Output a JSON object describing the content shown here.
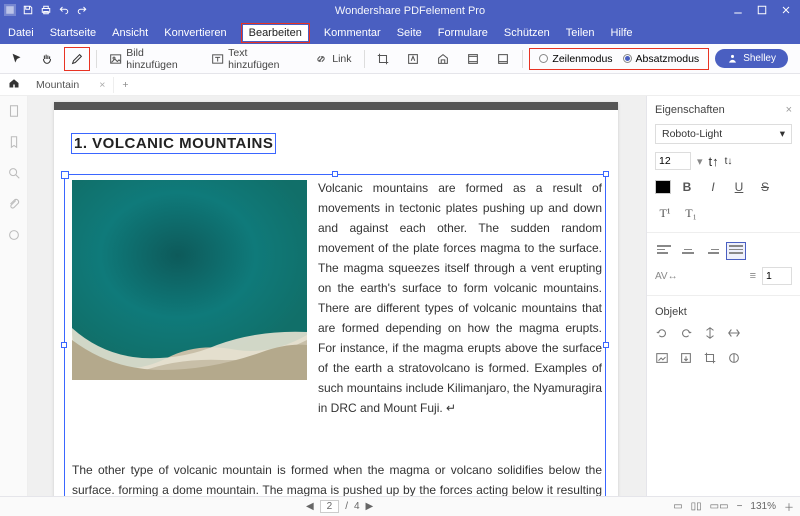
{
  "titlebar": {
    "title": "Wondershare PDFelement Pro"
  },
  "menubar": [
    "Datei",
    "Startseite",
    "Ansicht",
    "Konvertieren",
    "Bearbeiten",
    "Kommentar",
    "Seite",
    "Formulare",
    "Schützen",
    "Teilen",
    "Hilfe"
  ],
  "menubar_active": "Bearbeiten",
  "toolbar": {
    "add_image": "Bild hinzufügen",
    "add_text": "Text hinzufügen",
    "link": "Link",
    "line_mode": "Zeilenmodus",
    "paragraph_mode": "Absatzmodus",
    "selected_mode": "paragraph",
    "user": "Shelley"
  },
  "tab": {
    "name": "Mountain"
  },
  "document": {
    "heading": "1. VOLCANIC MOUNTAINS",
    "para1": "Volcanic mountains are formed as a result of movements in tectonic plates pushing up and down and against each other. The sudden random movement of the plate forces magma to the surface. The magma squeezes itself through a vent erupting on the earth's surface to form volcanic mountains. There are different types of volcanic mountains that are formed depending on how the magma erupts. For instance, if the magma erupts above the surface of the earth a stratovolcano is formed. Examples of such mountains include Kilimanjaro, the Nyamuragira in DRC and Mount Fuji. ↵",
    "para2": "The other type of volcanic mountain is formed when the magma or volcano solidifies below the surface. forming a dome mountain. The magma is pushed up by the forces acting below it resulting in"
  },
  "properties": {
    "title": "Eigenschaften",
    "font": "Roboto-Light",
    "size": "12",
    "object_title": "Objekt",
    "line_spacing": "1"
  },
  "statusbar": {
    "page": "2",
    "sep": "/",
    "total": "4",
    "zoom": "131%"
  }
}
